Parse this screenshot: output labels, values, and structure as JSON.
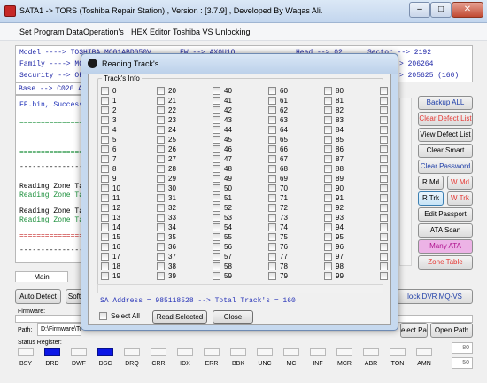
{
  "window": {
    "title": "SATA1 -> TORS (Toshiba Repair Station) , Version : [3.7.9] , Developed By Waqas Ali.",
    "minimize": "–",
    "maximize": "□",
    "close": "✕"
  },
  "menu": [
    "Set Program Data",
    "Operation's",
    "HEX Editor",
    "Toshiba VS Unlocking"
  ],
  "info": {
    "model": "Model ----> TOSHIBA MQ01ABD050V",
    "family": "Family ----> MQ01A",
    "fw": "FW --> AX0U1O",
    "head": "Head --> 02",
    "sector": "Sector --> 2192",
    "security": "Security --> OFF",
    "right1": "> 206264",
    "right2": "> 205625 (160)",
    "base": "Base --> C020  Alt"
  },
  "log": [
    {
      "text": "FF.bin, Successfu",
      "color": "#1c2fb8"
    },
    {
      "text": "==================",
      "color": "#1a8f3a"
    },
    {
      "text": "==================",
      "color": "#1a8f3a"
    },
    {
      "text": "------------------",
      "color": "#000000"
    },
    {
      "text": "Reading Zone Tabl",
      "color": "#000000"
    },
    {
      "text": "Reading Zone Tabl",
      "color": "#1a8f3a"
    },
    {
      "text": "Reading Zone Tabl",
      "color": "#000000"
    },
    {
      "text": "Reading Zone Tabl",
      "color": "#1a8f3a"
    },
    {
      "text": "==================",
      "color": "#c62828"
    },
    {
      "text": "------------------",
      "color": "#000000"
    }
  ],
  "right_buttons": {
    "backup_all": "Backup ALL",
    "clear_defect_list": "Clear Defect List",
    "view_defect_list": "View Defect List",
    "clear_smart": "Clear Smart",
    "clear_password": "Clear Password",
    "r_md": "R Md",
    "w_md": "W Md",
    "r_trk": "R Trk",
    "w_trk": "W Trk",
    "edit_passport": "Edit Passport",
    "ata_scan": "ATA Scan",
    "many_ata": "Many ATA",
    "zone_table": "Zone Table"
  },
  "tab_main": "Main",
  "auto_detect": "Auto Detect",
  "soft_label": "Soft",
  "unlock_label": "lock DVR MQ-VS",
  "firmware_label": "Firmware:",
  "path_label": "Path:",
  "path_value": "D:\\Firmware\\Toshiba",
  "select_path": "elect Path",
  "open_path": "Open Path",
  "status_register_label": "Status Register:",
  "status_flags": [
    {
      "name": "BSY",
      "on": false
    },
    {
      "name": "DRD",
      "on": true
    },
    {
      "name": "DWF",
      "on": false
    },
    {
      "name": "DSC",
      "on": true
    },
    {
      "name": "DRQ",
      "on": false
    },
    {
      "name": "CRR",
      "on": false
    },
    {
      "name": "IDX",
      "on": false
    },
    {
      "name": "ERR",
      "on": false
    },
    {
      "name": "BBK",
      "on": false
    },
    {
      "name": "UNC",
      "on": false
    },
    {
      "name": "MC",
      "on": false
    },
    {
      "name": "INF",
      "on": false
    },
    {
      "name": "MCR",
      "on": false
    },
    {
      "name": "ABR",
      "on": false
    },
    {
      "name": "TON",
      "on": false
    },
    {
      "name": "AMN",
      "on": false
    }
  ],
  "side_numbers": [
    "80",
    "50"
  ],
  "dialog": {
    "title": "Reading Track's",
    "group_label": "Track's Info",
    "tracks": [
      "0",
      "1",
      "2",
      "3",
      "4",
      "5",
      "6",
      "7",
      "8",
      "9",
      "10",
      "11",
      "12",
      "13",
      "14",
      "15",
      "16",
      "17",
      "18",
      "19",
      "20",
      "21",
      "22",
      "23",
      "24",
      "25",
      "26",
      "27",
      "28",
      "29",
      "30",
      "31",
      "32",
      "33",
      "34",
      "35",
      "36",
      "37",
      "38",
      "39",
      "40",
      "41",
      "42",
      "43",
      "44",
      "45",
      "46",
      "47",
      "48",
      "49",
      "50",
      "51",
      "52",
      "53",
      "54",
      "55",
      "56",
      "57",
      "58",
      "59",
      "60",
      "61",
      "62",
      "63",
      "64",
      "65",
      "66",
      "67",
      "68",
      "69",
      "70",
      "71",
      "72",
      "73",
      "74",
      "75",
      "76",
      "77",
      "78",
      "79",
      "80",
      "81",
      "82",
      "83",
      "84",
      "85",
      "86",
      "87",
      "88",
      "89",
      "90",
      "91",
      "92",
      "93",
      "94",
      "95",
      "96",
      "97",
      "98",
      "99"
    ],
    "sa_address": "SA Address = 985118528 --> Total Track's = 160",
    "select_all": "Select All",
    "read_selected": "Read Selected",
    "close": "Close"
  },
  "colors": {
    "accent_blue": "#2028a8",
    "red": "#e53935",
    "pink": "#ecb3e6",
    "led_on": "#0b16e6"
  }
}
